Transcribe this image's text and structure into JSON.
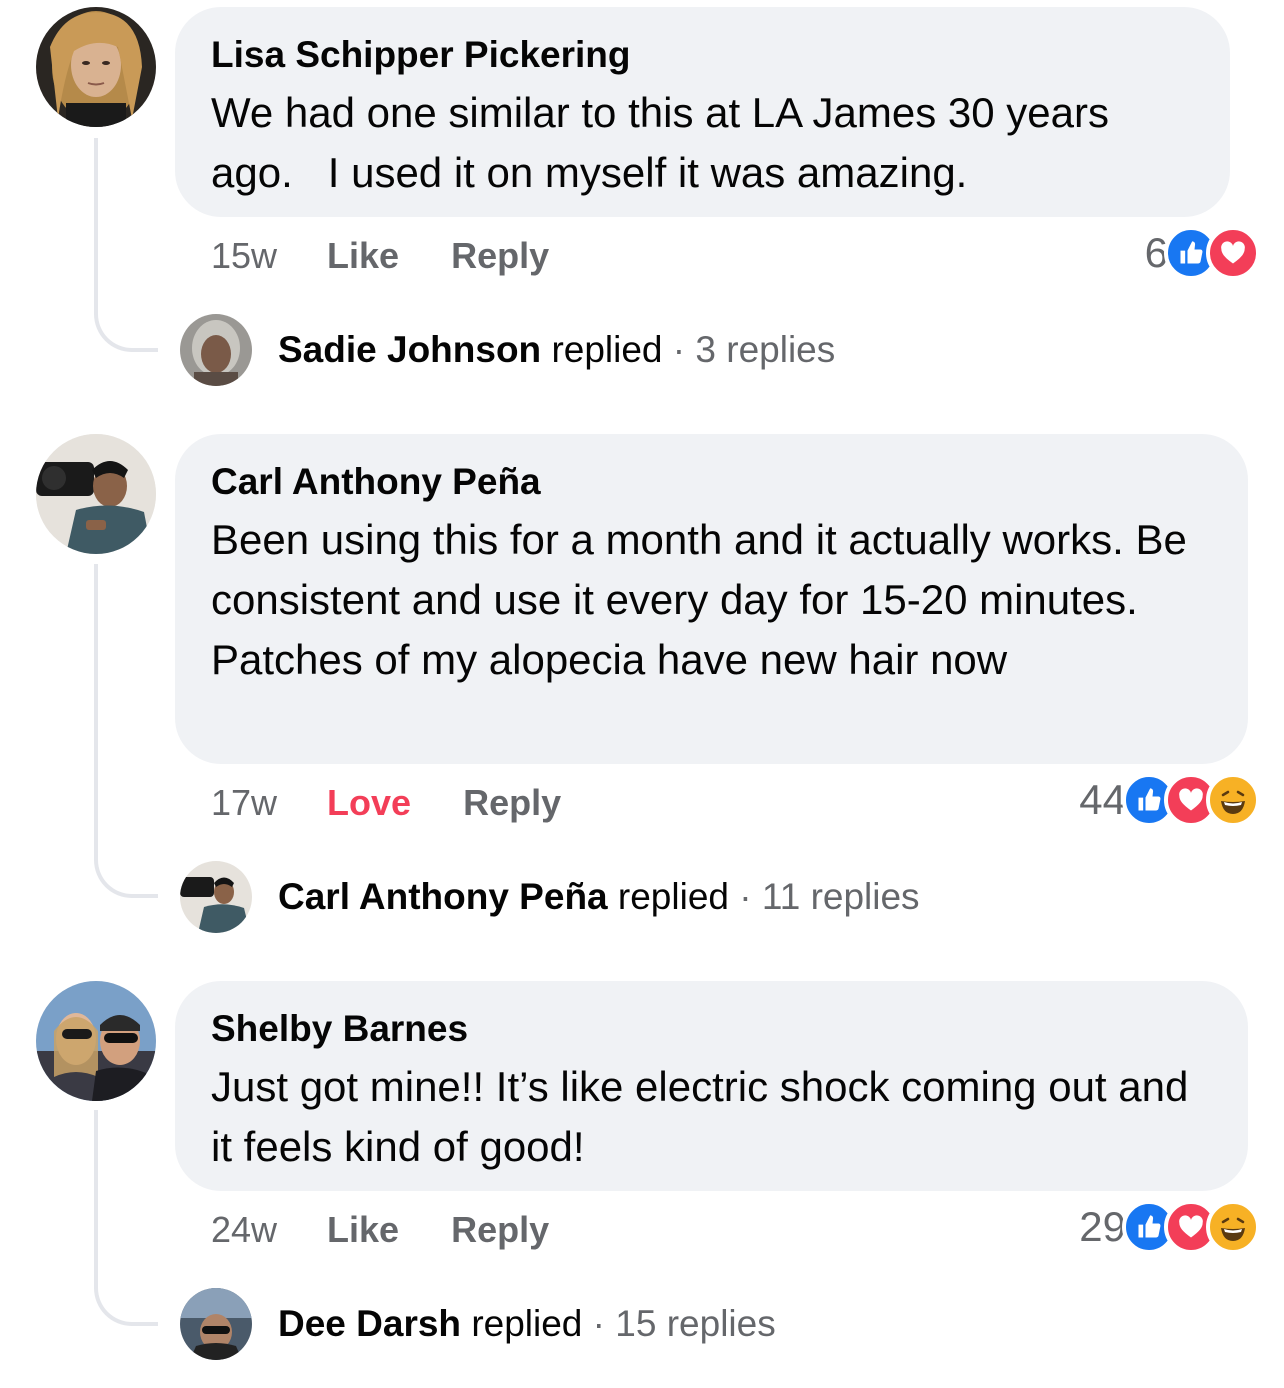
{
  "comments": [
    {
      "author": "Lisa Schipper Pickering",
      "text": "We had one similar to this at LA James 30 years ago.   I used it on myself it was amazing.",
      "time": "15w",
      "like_label": "Like",
      "reply_label": "Reply",
      "reaction_count": "6",
      "reactions": [
        "like-icon",
        "love-icon"
      ],
      "replied_by": "Sadie Johnson",
      "replied_word": "replied",
      "separator": "·",
      "replies": "3 replies"
    },
    {
      "author": "Carl Anthony Peña",
      "text": "Been using this for a month and it actually works. Be consistent and use it every day for 15-20 minutes. Patches of my alopecia have new hair now",
      "time": "17w",
      "like_label": "Love",
      "reply_label": "Reply",
      "reaction_count": "44",
      "reactions": [
        "like-icon",
        "love-icon",
        "haha-icon"
      ],
      "replied_by": "Carl Anthony Peña",
      "replied_word": "replied",
      "separator": "·",
      "replies": "11 replies"
    },
    {
      "author": "Shelby Barnes",
      "text": "Just got mine!! It’s like electric shock coming out and it feels kind of good!",
      "time": "24w",
      "like_label": "Like",
      "reply_label": "Reply",
      "reaction_count": "29",
      "reactions": [
        "like-icon",
        "love-icon",
        "haha-icon"
      ],
      "replied_by": "Dee Darsh",
      "replied_word": "replied",
      "separator": "·",
      "replies": "15 replies"
    }
  ],
  "colors": {
    "like": "#1877f2",
    "love": "#f33e58",
    "haha": "#f7b125",
    "bubble": "#f0f2f5",
    "secondary_text": "#65676b"
  }
}
